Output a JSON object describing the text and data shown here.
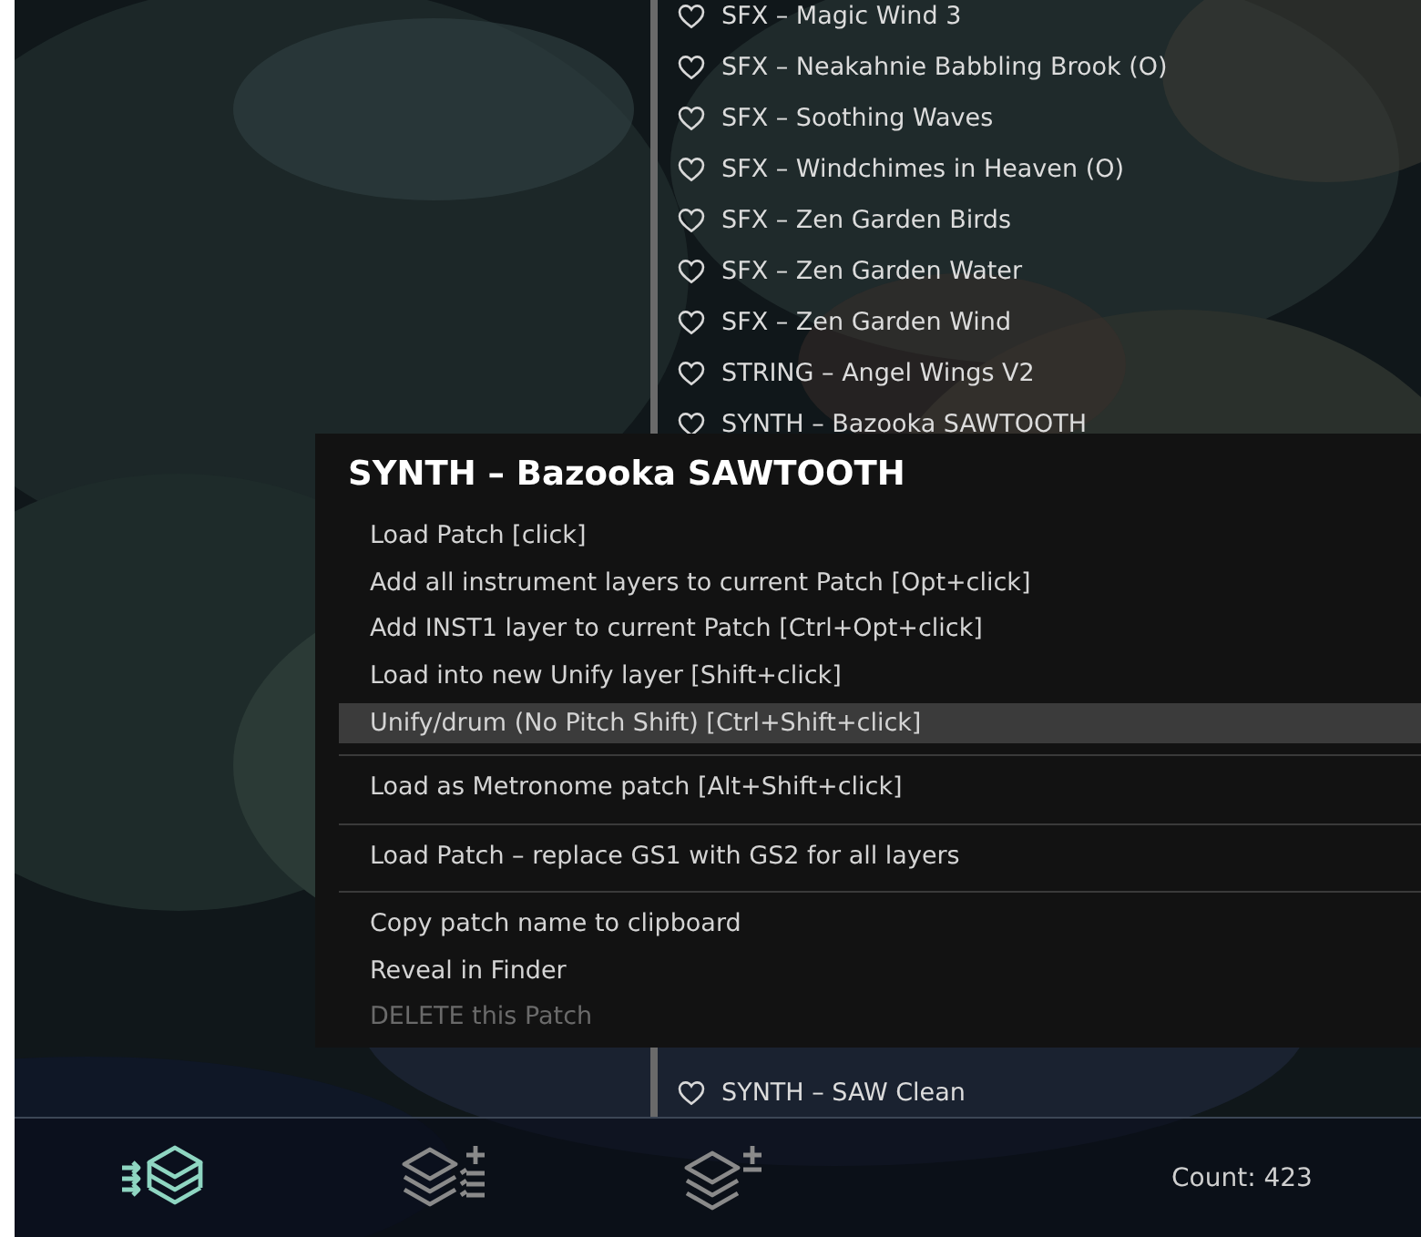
{
  "patch_list": {
    "items": [
      {
        "name": "SFX – Magic Wind 3",
        "favorite": false
      },
      {
        "name": "SFX – Neakahnie Babbling Brook (O)",
        "favorite": false
      },
      {
        "name": "SFX – Soothing Waves",
        "favorite": false
      },
      {
        "name": "SFX – Windchimes in Heaven (O)",
        "favorite": false
      },
      {
        "name": "SFX – Zen Garden Birds",
        "favorite": false
      },
      {
        "name": "SFX – Zen Garden Water",
        "favorite": false
      },
      {
        "name": "SFX – Zen Garden Wind",
        "favorite": false
      },
      {
        "name": "STRING – Angel Wings V2",
        "favorite": false
      },
      {
        "name": "SYNTH – Bazooka SAWTOOTH",
        "favorite": false
      }
    ],
    "bottom_items": [
      {
        "name": "SYNTH – SAW Clean",
        "favorite": false
      }
    ]
  },
  "context_menu": {
    "title": "SYNTH – Bazooka SAWTOOTH",
    "groups": [
      [
        {
          "label": "Load Patch [click]",
          "selected": false,
          "disabled": false
        },
        {
          "label": "Add all instrument layers to current Patch [Opt+click]",
          "selected": false,
          "disabled": false
        },
        {
          "label": "Add INST1 layer to current Patch [Ctrl+Opt+click]",
          "selected": false,
          "disabled": false
        },
        {
          "label": "Load into new Unify layer [Shift+click]",
          "selected": false,
          "disabled": false
        },
        {
          "label": "Unify/drum (No Pitch Shift) [Ctrl+Shift+click]",
          "selected": true,
          "disabled": false
        }
      ],
      [
        {
          "label": "Load as Metronome patch [Alt+Shift+click]",
          "selected": false,
          "disabled": false
        }
      ],
      [
        {
          "label": "Load Patch – replace GS1 with GS2 for all layers",
          "selected": false,
          "disabled": false
        }
      ],
      [
        {
          "label": "Copy patch name to clipboard",
          "selected": false,
          "disabled": false
        },
        {
          "label": "Reveal in Finder",
          "selected": false,
          "disabled": false
        },
        {
          "label": "DELETE this Patch",
          "selected": false,
          "disabled": true
        }
      ]
    ]
  },
  "toolbar": {
    "buttons": [
      {
        "kind": "load",
        "selected": true
      },
      {
        "kind": "add-layers",
        "selected": false
      },
      {
        "kind": "add-layer",
        "selected": false
      }
    ],
    "count": "Count: 423"
  }
}
